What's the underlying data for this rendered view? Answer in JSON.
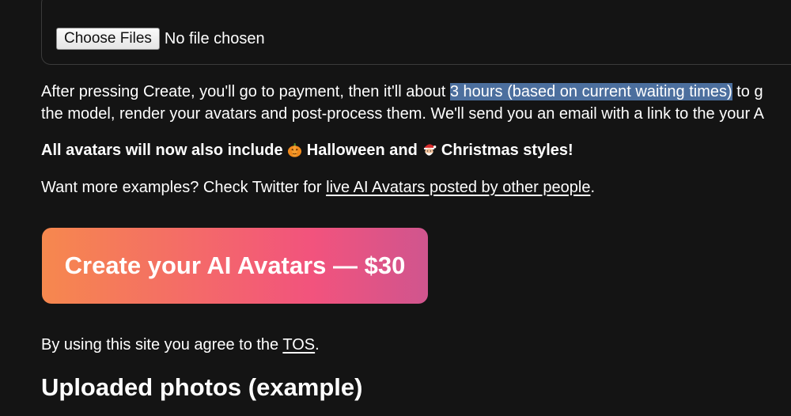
{
  "upload": {
    "button_label": "Choose Files",
    "status_text": "No file chosen"
  },
  "info": {
    "line1_before": "After pressing Create, you'll go to payment, then it'll about ",
    "line1_highlight": "3 hours (based on current waiting times)",
    "line1_after": " to g",
    "line2": "the model, render your avatars and post-process them. We'll send you an email with a link to the your A"
  },
  "announcement": {
    "prefix": "All avatars will now also include ",
    "halloween_label": " Halloween and ",
    "christmas_label": " Christmas styles!",
    "halloween_icon": "pumpkin-icon",
    "christmas_icon": "santa-icon"
  },
  "examples": {
    "prefix": "Want more examples? Check Twitter for ",
    "link_text": "live AI Avatars posted by other people",
    "suffix": "."
  },
  "cta": {
    "label": "Create your AI Avatars — $30",
    "gradient_start": "#f6884e",
    "gradient_mid": "#f2537d",
    "gradient_end": "#d0558e"
  },
  "terms": {
    "prefix": "By using this site you agree to the ",
    "link_text": "TOS",
    "suffix": "."
  },
  "section": {
    "title": "Uploaded photos (example)"
  },
  "colors": {
    "background": "#141414",
    "text": "#ffffff",
    "selection_highlight": "#4c6f9e"
  }
}
